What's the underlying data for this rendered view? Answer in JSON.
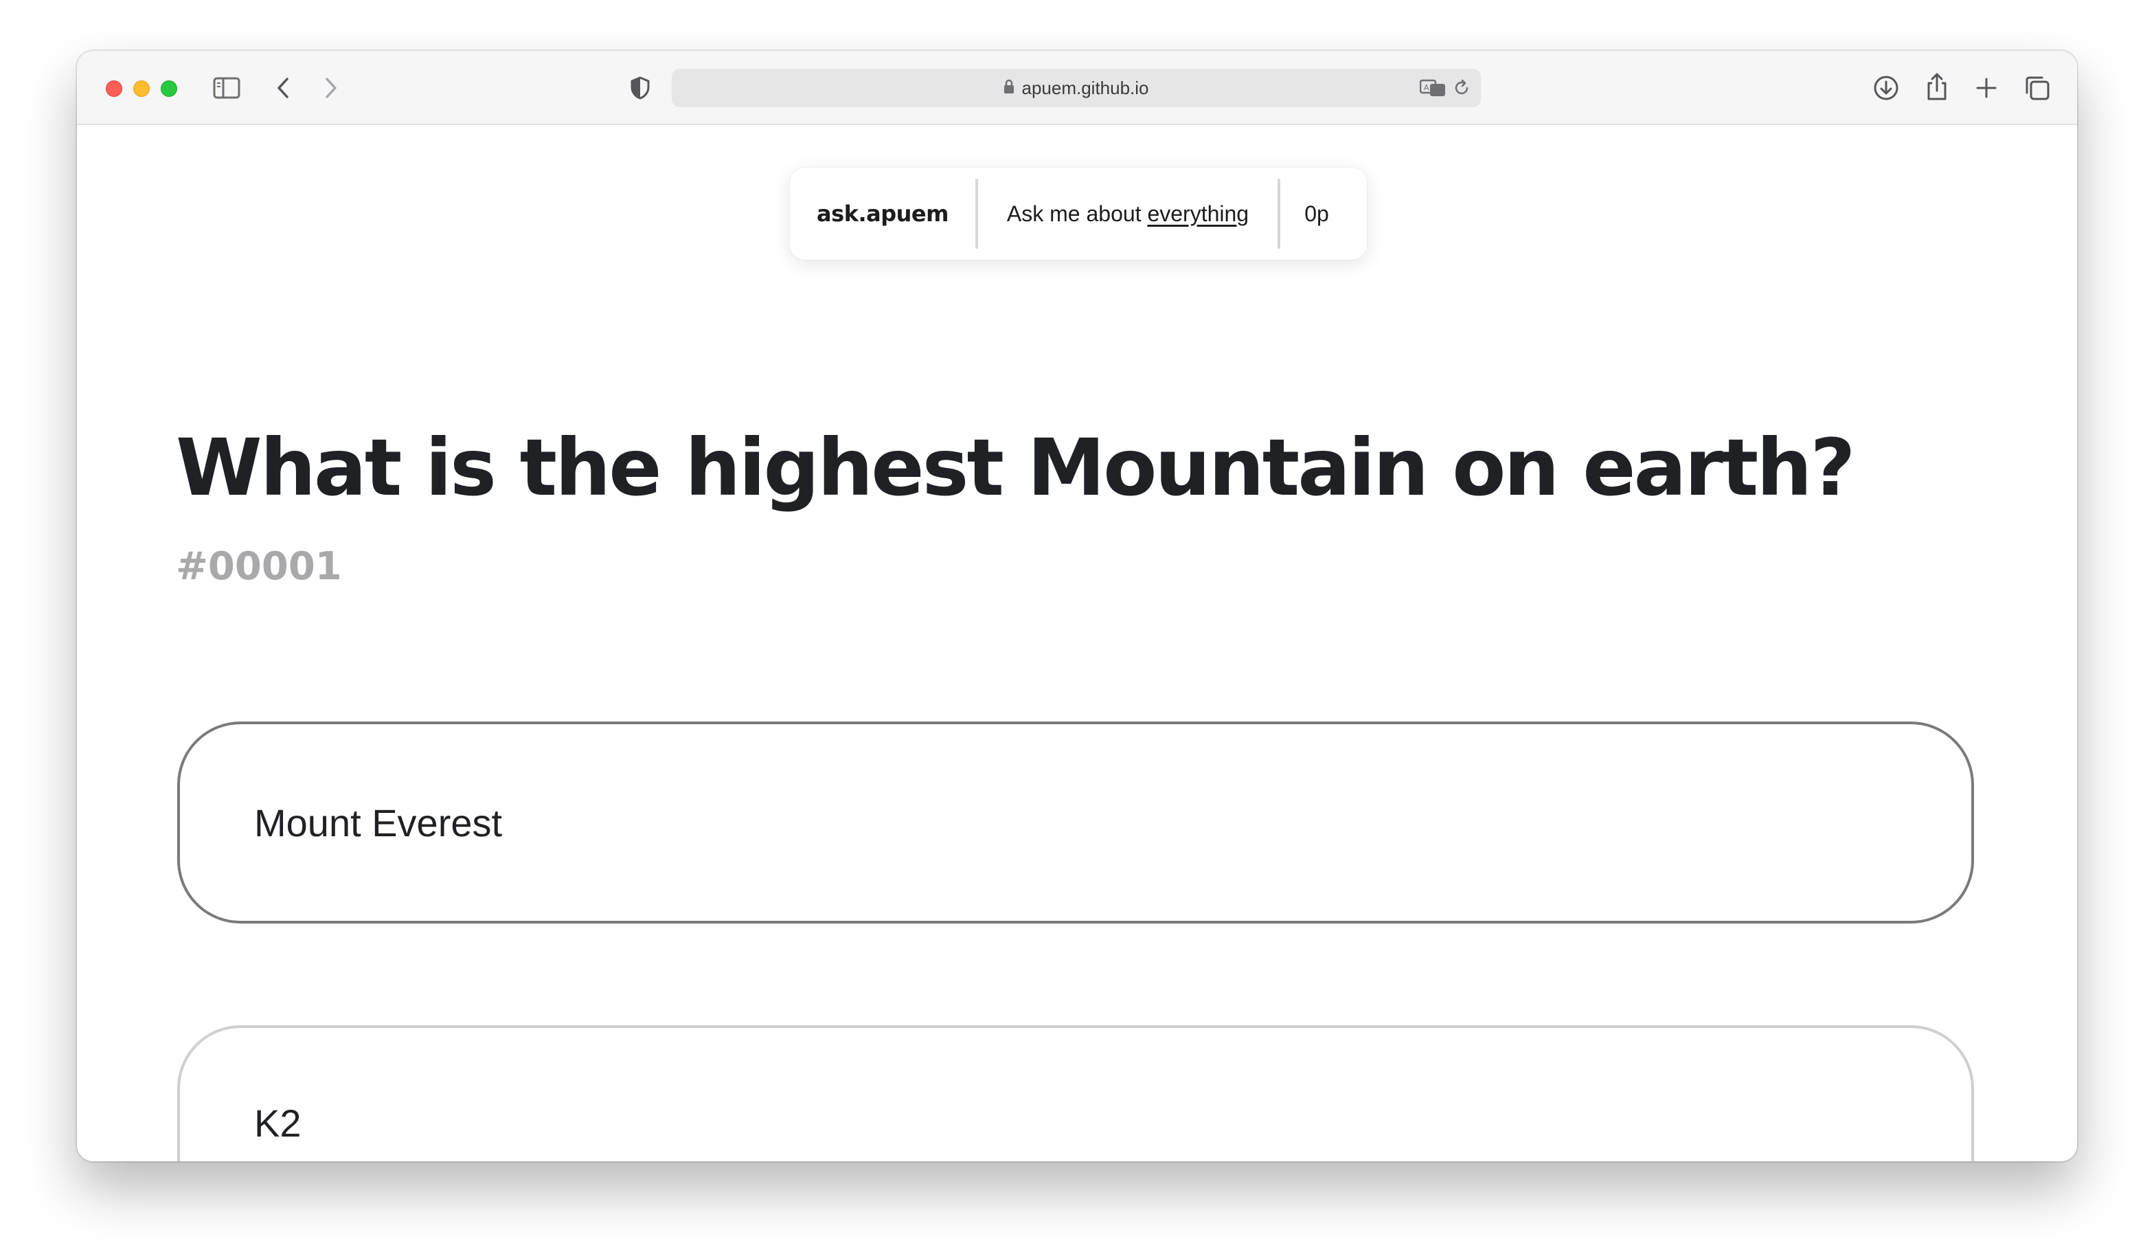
{
  "browser": {
    "url": "apuem.github.io",
    "icons": [
      "sidebar-icon",
      "back-icon",
      "forward-icon",
      "shield-icon",
      "lock-icon",
      "translate-icon",
      "reload-icon",
      "download-icon",
      "share-icon",
      "new-tab-icon",
      "tabs-overview-icon"
    ]
  },
  "nav": {
    "brand": "ask.apuem",
    "tagline_prefix": "Ask me about ",
    "tagline_link": "everything",
    "points": "0p"
  },
  "question": {
    "title": "What is the highest Mountain on earth?",
    "id": "#00001"
  },
  "answers": [
    {
      "label": "Mount Everest"
    },
    {
      "label": "K2"
    }
  ]
}
